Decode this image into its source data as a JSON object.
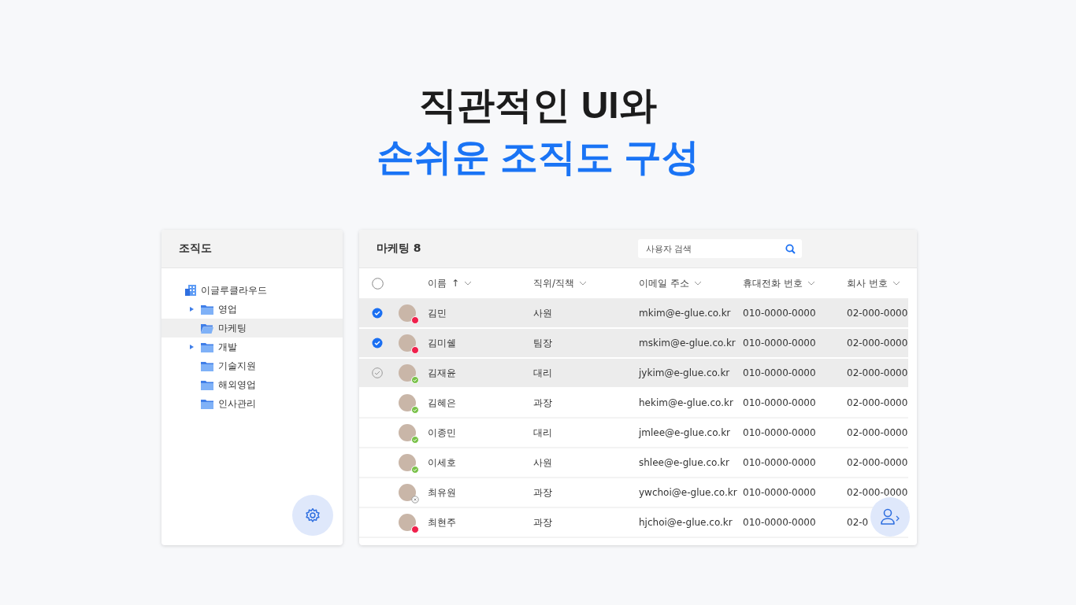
{
  "headline": {
    "line_1": "직관적인 UI와",
    "line_2": "손쉬운 조직도 구성"
  },
  "org_panel": {
    "title": "조직도",
    "tree": {
      "label": "이글루클라우드",
      "children": [
        {
          "label": "영업",
          "expandable": true,
          "selected": false
        },
        {
          "label": "마케팅",
          "expandable": false,
          "selected": true
        },
        {
          "label": "개발",
          "expandable": true,
          "selected": false
        },
        {
          "label": "기술지원",
          "expandable": false,
          "selected": false
        },
        {
          "label": "해외영업",
          "expandable": false,
          "selected": false
        },
        {
          "label": "인사관리",
          "expandable": false,
          "selected": false
        }
      ]
    }
  },
  "member_panel": {
    "title": "마케팅 8",
    "search": {
      "placeholder": "사용자 검색"
    },
    "select_all": {
      "checked": false
    },
    "columns": [
      {
        "label": "이름",
        "sort": "↑"
      },
      {
        "label": "직위/직책"
      },
      {
        "label": "이메일 주소"
      },
      {
        "label": "휴대전화 번호"
      },
      {
        "label": "회사 번호"
      }
    ],
    "rows": [
      {
        "selected": true,
        "checked": true,
        "kind": "busy",
        "name": "김민",
        "position": "사원",
        "email": "mkim@e-glue.co.kr",
        "mobile": "010-0000-0000",
        "office": "02-000-0000"
      },
      {
        "selected": true,
        "checked": true,
        "kind": "busy",
        "name": "김미쉘",
        "position": "팀장",
        "email": "mskim@e-glue.co.kr",
        "mobile": "010-0000-0000",
        "office": "02-000-0000"
      },
      {
        "selected": true,
        "checked": false,
        "kind": "online",
        "name": "김재윤",
        "position": "대리",
        "email": "jykim@e-glue.co.kr",
        "mobile": "010-0000-0000",
        "office": "02-000-0000"
      },
      {
        "selected": false,
        "checked": false,
        "kind": "online",
        "name": "김혜은",
        "position": "과장",
        "email": "hekim@e-glue.co.kr",
        "mobile": "010-0000-0000",
        "office": "02-000-0000"
      },
      {
        "selected": false,
        "checked": false,
        "kind": "online",
        "name": "이종민",
        "position": "대리",
        "email": "jmlee@e-glue.co.kr",
        "mobile": "010-0000-0000",
        "office": "02-000-0000"
      },
      {
        "selected": false,
        "checked": false,
        "kind": "online",
        "name": "이세호",
        "position": "사원",
        "email": "shlee@e-glue.co.kr",
        "mobile": "010-0000-0000",
        "office": "02-000-0000"
      },
      {
        "selected": false,
        "checked": false,
        "kind": "offline",
        "name": "최유원",
        "position": "과장",
        "email": "ywchoi@e-glue.co.kr",
        "mobile": "010-0000-0000",
        "office": "02-000-0000"
      },
      {
        "selected": false,
        "checked": false,
        "kind": "busy",
        "name": "최현주",
        "position": "과장",
        "email": "hjchoi@e-glue.co.kr",
        "mobile": "010-0000-0000",
        "office": "02-0"
      }
    ]
  }
}
